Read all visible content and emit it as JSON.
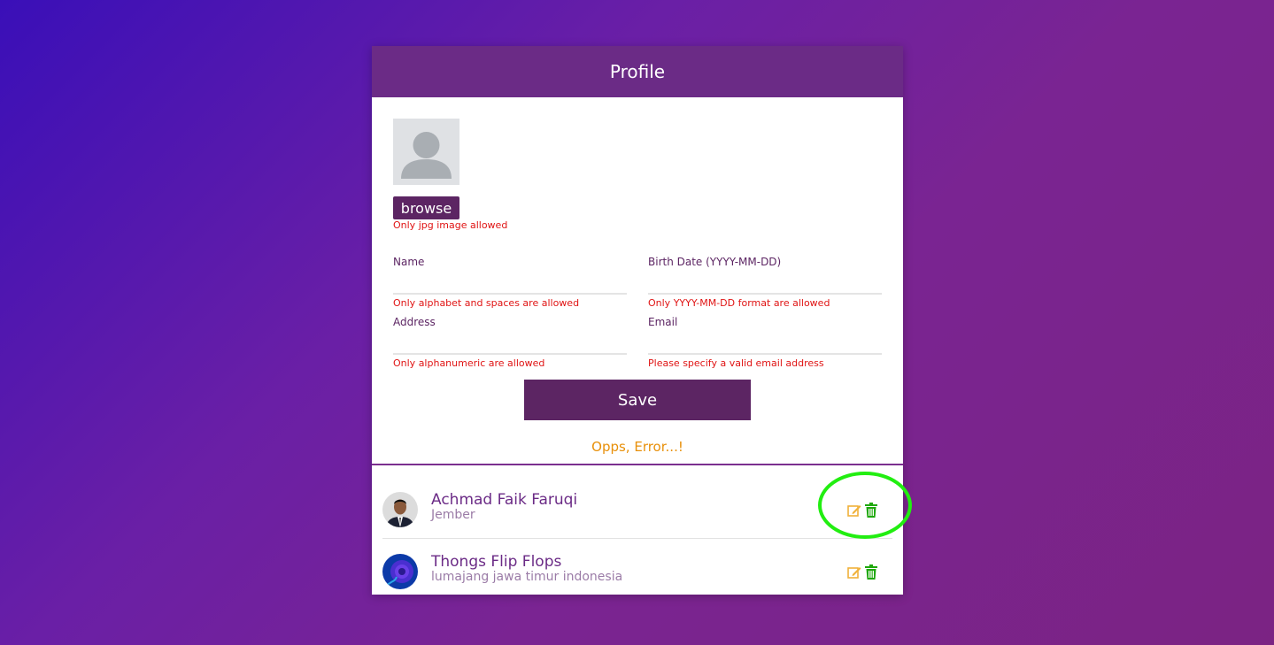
{
  "header": {
    "title": "Profile"
  },
  "photo": {
    "browse_label": "browse",
    "hint": "Only jpg image allowed"
  },
  "form": {
    "name": {
      "label": "Name",
      "value": "",
      "hint": "Only alphabet and spaces are allowed"
    },
    "birth_date": {
      "label": "Birth Date (YYYY-MM-DD)",
      "value": "",
      "hint": "Only YYYY-MM-DD format are allowed"
    },
    "address": {
      "label": "Address",
      "value": "",
      "hint": "Only alphanumeric are allowed"
    },
    "email": {
      "label": "Email",
      "value": "",
      "hint": "Please specify a valid email address"
    },
    "save_label": "Save",
    "status_message": "Opps, Error...!"
  },
  "users": [
    {
      "name": "Achmad Faik Faruqi",
      "city": "Jember",
      "avatar_icon": "person-photo"
    },
    {
      "name": "Thongs Flip Flops",
      "city": "lumajang jawa timur indonesia",
      "avatar_icon": "rose-photo"
    }
  ],
  "colors": {
    "accent": "#5c2563",
    "header": "#6b2b86",
    "error": "#e01414",
    "status_warning": "#e8900a",
    "edit_icon": "#f0b13a",
    "delete_icon": "#1ea80a",
    "highlight": "#22ee11"
  },
  "icons": {
    "edit": "edit-icon",
    "delete": "trash-icon",
    "placeholder_avatar": "user-placeholder-icon"
  }
}
